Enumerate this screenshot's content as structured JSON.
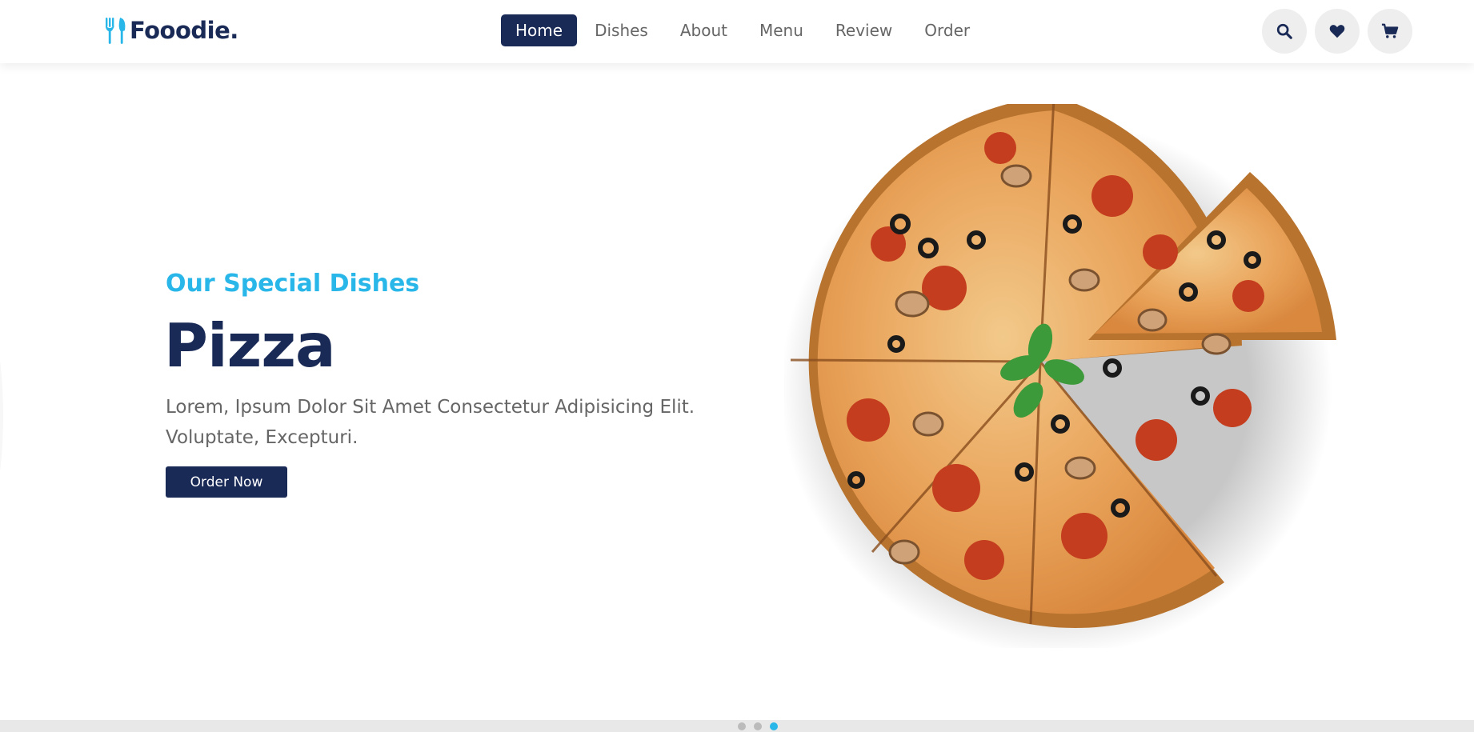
{
  "brand": {
    "name": "Fooodie.",
    "icon": "utensils-icon"
  },
  "nav": {
    "items": [
      {
        "label": "Home",
        "active": true
      },
      {
        "label": "Dishes",
        "active": false
      },
      {
        "label": "About",
        "active": false
      },
      {
        "label": "Menu",
        "active": false
      },
      {
        "label": "Review",
        "active": false
      },
      {
        "label": "Order",
        "active": false
      }
    ]
  },
  "header_actions": [
    {
      "icon": "search-icon"
    },
    {
      "icon": "heart-icon"
    },
    {
      "icon": "cart-icon"
    }
  ],
  "hero": {
    "subtitle": "Our Special Dishes",
    "title": "Pizza",
    "description_line1": "Lorem, Ipsum Dolor Sit Amet Consectetur Adipisicing Elit.",
    "description_line2": "Voluptate, Excepturi.",
    "cta_label": "Order Now"
  },
  "slider": {
    "total": 3,
    "active_index": 3
  },
  "colors": {
    "primary": "#1a2a57",
    "accent": "#29b6e8",
    "text_muted": "#666666",
    "icon_bg": "#eeeeee"
  }
}
